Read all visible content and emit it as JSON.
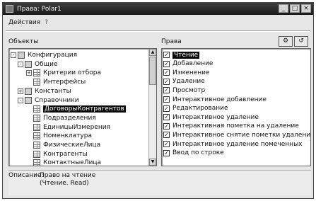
{
  "window": {
    "title": "Права: Polar1"
  },
  "menubar": {
    "actions": "Действия",
    "help_icon": "help-icon"
  },
  "left": {
    "header": "Объекты",
    "tree": [
      {
        "id": "config",
        "label": "Конфигурация",
        "icon": "folder-icon",
        "expander": "-"
      },
      {
        "id": "general",
        "label": "Общие",
        "icon": "folder-icon",
        "expander": "-"
      },
      {
        "id": "criteria",
        "label": "Критерии отбора",
        "icon": "grid-icon",
        "expander": "+"
      },
      {
        "id": "interfaces",
        "label": "Интерфейсы",
        "icon": "grid-icon",
        "expander": ""
      },
      {
        "id": "constants",
        "label": "Константы",
        "icon": "folder-icon",
        "expander": "+"
      },
      {
        "id": "catalogs",
        "label": "Справочники",
        "icon": "folder-icon",
        "expander": "-"
      },
      {
        "id": "selected",
        "label": "ДоговорыКонтрагентов",
        "icon": "grid-icon",
        "expander": "",
        "selected": true
      },
      {
        "id": "divisions",
        "label": "Подразделения",
        "icon": "grid-icon",
        "expander": ""
      },
      {
        "id": "units",
        "label": "ЕдиницыИзмерения",
        "icon": "grid-icon",
        "expander": ""
      },
      {
        "id": "nomenclature",
        "label": "Номенклатура",
        "icon": "grid-icon",
        "expander": ""
      },
      {
        "id": "persons",
        "label": "ФизическиеЛица",
        "icon": "grid-icon",
        "expander": ""
      },
      {
        "id": "contractors",
        "label": "Контрагенты",
        "icon": "grid-icon",
        "expander": ""
      },
      {
        "id": "contacts",
        "label": "КонтактныеЛица",
        "icon": "grid-icon",
        "expander": ""
      }
    ]
  },
  "right": {
    "header": "Права",
    "rights": [
      {
        "label": "Чтение",
        "checked": true,
        "selected": true
      },
      {
        "label": "Добавление",
        "checked": true
      },
      {
        "label": "Изменение",
        "checked": true
      },
      {
        "label": "Удаление",
        "checked": true
      },
      {
        "label": "Просмотр",
        "checked": true
      },
      {
        "label": "Интерактивное добавление",
        "checked": true
      },
      {
        "label": "Редактирование",
        "checked": true
      },
      {
        "label": "Интерактивное удаление",
        "checked": true
      },
      {
        "label": "Интерактивная пометка на удаление",
        "checked": true
      },
      {
        "label": "Интерактивное снятие пометки удаления",
        "checked": true
      },
      {
        "label": "Интерактивное удаление помеченных",
        "checked": true
      },
      {
        "label": "Ввод по строке",
        "checked": true
      }
    ]
  },
  "description": {
    "label": "Описание:",
    "line1": "Право на чтение",
    "line2": "(Чтение. Read)"
  }
}
